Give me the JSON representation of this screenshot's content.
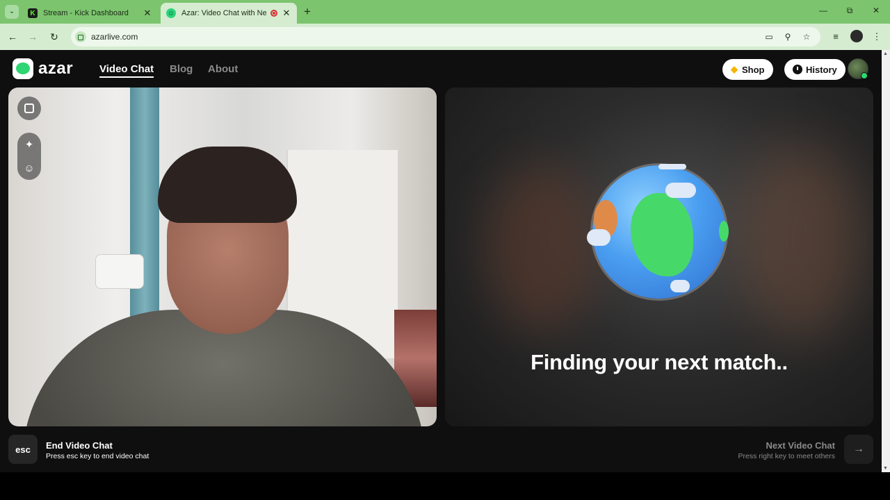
{
  "browser": {
    "tabs": [
      {
        "title": "Stream - Kick Dashboard",
        "favicon": "kick-logo-icon",
        "active": false
      },
      {
        "title": "Azar: Video Chat with New",
        "favicon": "azar-logo-icon",
        "active": true,
        "recording": true
      }
    ],
    "url": "azarlive.com",
    "accent": "#7cc46e"
  },
  "site": {
    "logo_text": "azar",
    "nav": [
      {
        "label": "Video Chat",
        "active": true
      },
      {
        "label": "Blog",
        "active": false
      },
      {
        "label": "About",
        "active": false
      }
    ],
    "shop_label": "Shop",
    "history_label": "History"
  },
  "panels": {
    "matching_text": "Finding your next match.."
  },
  "controls": {
    "esc_key": "esc",
    "end_title": "End Video Chat",
    "end_subtitle": "Press esc key to end video chat",
    "next_title": "Next Video Chat",
    "next_subtitle": "Press right key to meet others",
    "next_icon": "arrow-right-icon"
  }
}
